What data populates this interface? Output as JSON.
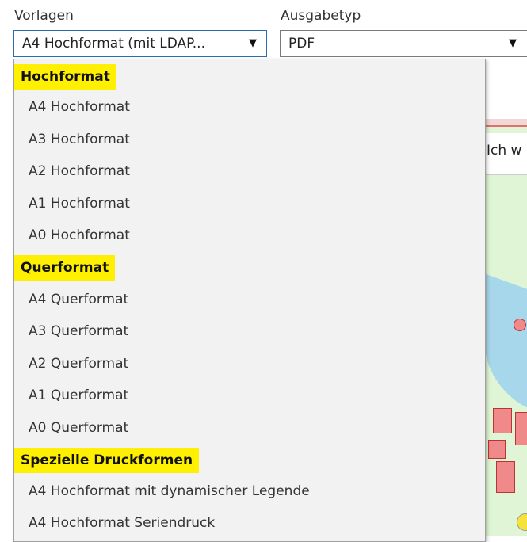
{
  "vorlagen": {
    "label": "Vorlagen",
    "selected": "A4 Hochformat (mit LDAP...",
    "arrow": "▼"
  },
  "ausgabetyp": {
    "label": "Ausgabetyp",
    "selected": "PDF",
    "arrow": "▼"
  },
  "map": {
    "visible_text": "Ich w"
  },
  "dropdown": {
    "groups": [
      {
        "header": "Hochformat",
        "items": [
          "A4 Hochformat",
          "A3 Hochformat",
          "A2 Hochformat",
          "A1 Hochformat",
          "A0 Hochformat"
        ]
      },
      {
        "header": "Querformat",
        "items": [
          "A4 Querformat",
          "A3 Querformat",
          "A2 Querformat",
          "A1 Querformat",
          "A0 Querformat"
        ]
      },
      {
        "header": "Spezielle Druckformen",
        "items": [
          "A4 Hochformat mit dynamischer Legende",
          "A4 Hochformat Seriendruck"
        ]
      }
    ]
  },
  "colors": {
    "group_highlight": "#ffef00",
    "dropdown_bg": "#f2f2f2",
    "map_green": "#dff5d5",
    "map_water": "#a7d7ea",
    "map_building": "#f08a8a"
  }
}
